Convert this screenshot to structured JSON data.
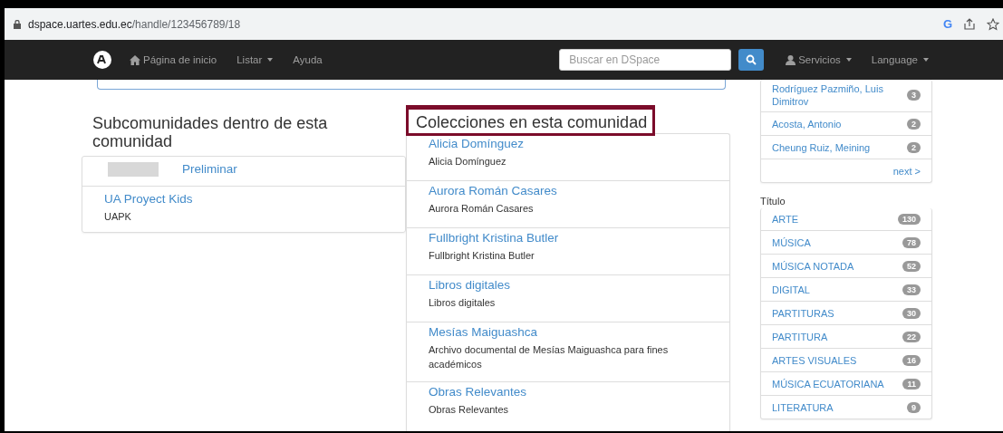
{
  "browser": {
    "url_host": "dspace.uartes.edu.ec",
    "url_path": "/handle/123456789/18",
    "account_letter": "G"
  },
  "navbar": {
    "items": [
      {
        "label": "Página de inicio",
        "kind": "home"
      },
      {
        "label": "Listar",
        "kind": "dropdown"
      },
      {
        "label": "Ayuda",
        "kind": "plain"
      }
    ],
    "search": {
      "placeholder": "Buscar en DSpace"
    },
    "right": [
      {
        "label": "Servicios",
        "kind": "user"
      },
      {
        "label": "Language",
        "kind": "dropdown"
      }
    ]
  },
  "subcommunities": {
    "title": "Subcomunidades dentro de esta comunidad",
    "items": [
      {
        "name": "Preliminar",
        "logo": true
      },
      {
        "name": "UA Proyect Kids",
        "description": "UAPK",
        "logo": false
      }
    ]
  },
  "collections": {
    "title": "Colecciones en esta comunidad",
    "items": [
      {
        "name": "Alicia Domínguez",
        "description": "Alicia Domínguez"
      },
      {
        "name": "Aurora Román Casares",
        "description": "Aurora Román Casares"
      },
      {
        "name": "Fullbright Kristina Butler",
        "description": "Fullbright Kristina Butler"
      },
      {
        "name": "Libros digitales",
        "description": "Libros digitales"
      },
      {
        "name": "Mesías Maiguashca",
        "description": "Archivo documental de Mesías Maiguashca para fines académicos"
      },
      {
        "name": "Obras Relevantes",
        "description": "Obras Relevantes"
      }
    ]
  },
  "authors": {
    "items": [
      {
        "label": "Rodríguez Pazmiño, Luis Dimitrov",
        "count": "3"
      },
      {
        "label": "Acosta, Antonio",
        "count": "2"
      },
      {
        "label": "Cheung Ruiz, Meining",
        "count": "2"
      }
    ],
    "next": "next >"
  },
  "titles": {
    "heading": "Título",
    "items": [
      {
        "label": "ARTE",
        "count": "130"
      },
      {
        "label": "MÚSICA",
        "count": "78"
      },
      {
        "label": "MÚSICA NOTADA",
        "count": "52"
      },
      {
        "label": "DIGITAL",
        "count": "33"
      },
      {
        "label": "PARTITURAS",
        "count": "30"
      },
      {
        "label": "PARTITURA",
        "count": "22"
      },
      {
        "label": "ARTES VISUALES",
        "count": "16"
      },
      {
        "label": "MÚSICA ECUATORIANA",
        "count": "11"
      },
      {
        "label": "LITERATURA",
        "count": "9"
      }
    ]
  }
}
